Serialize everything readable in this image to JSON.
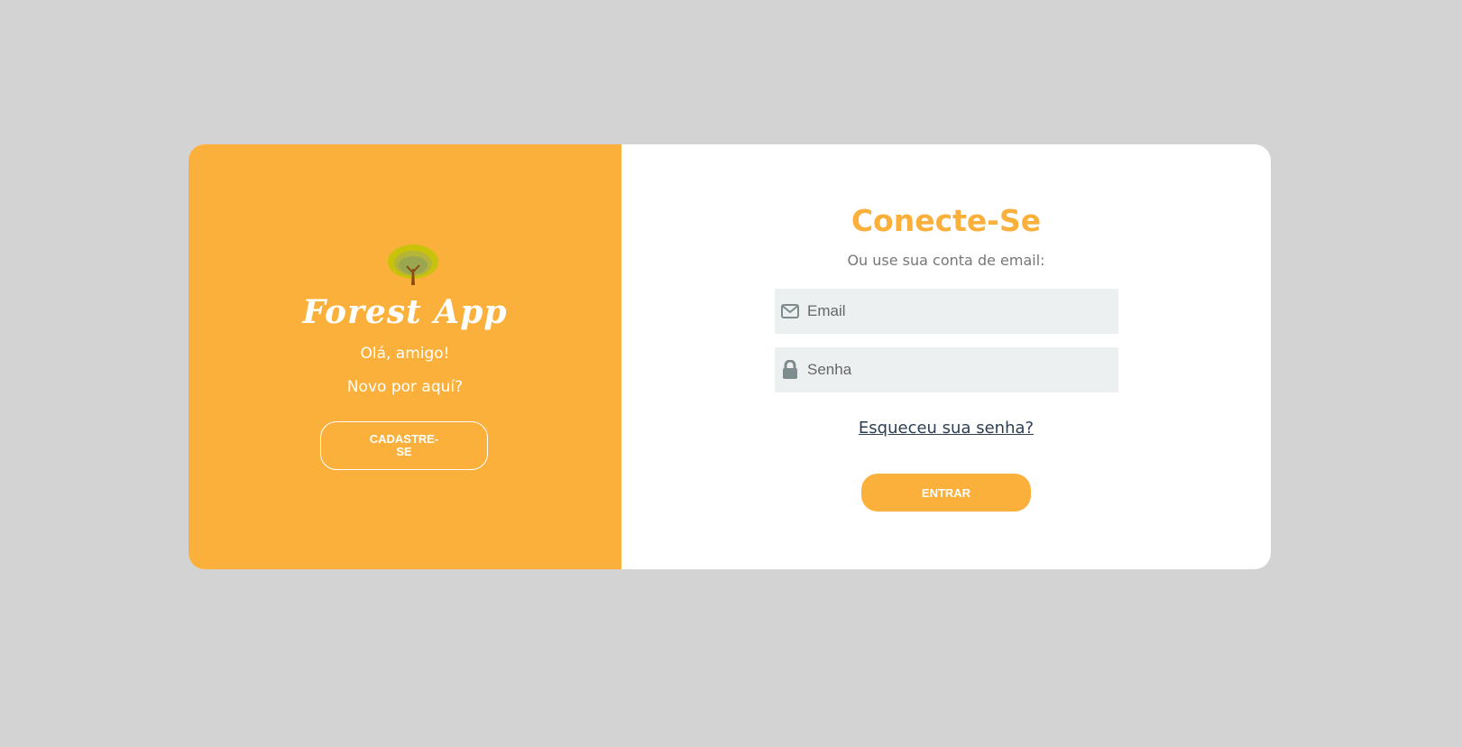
{
  "colors": {
    "background": "#d3d3d3",
    "accent": "#fbb03b",
    "card": "#ffffff",
    "field_bg": "#ecf0f1",
    "link": "#2c3e50"
  },
  "left": {
    "logo_icon": "tree-icon",
    "app_title": "Forest App",
    "greeting": "Olá, amigo!",
    "subgreeting": "Novo por aquí?",
    "signup_label": "CADASTRE-SE"
  },
  "right": {
    "title": "Conecte-Se",
    "subtitle": "Ou use sua conta de email:",
    "email": {
      "icon": "envelope-icon",
      "placeholder": "Email",
      "value": ""
    },
    "password": {
      "icon": "lock-icon",
      "placeholder": "Senha",
      "value": ""
    },
    "forgot_label": "Esqueceu sua senha?",
    "login_label": "ENTRAR"
  }
}
